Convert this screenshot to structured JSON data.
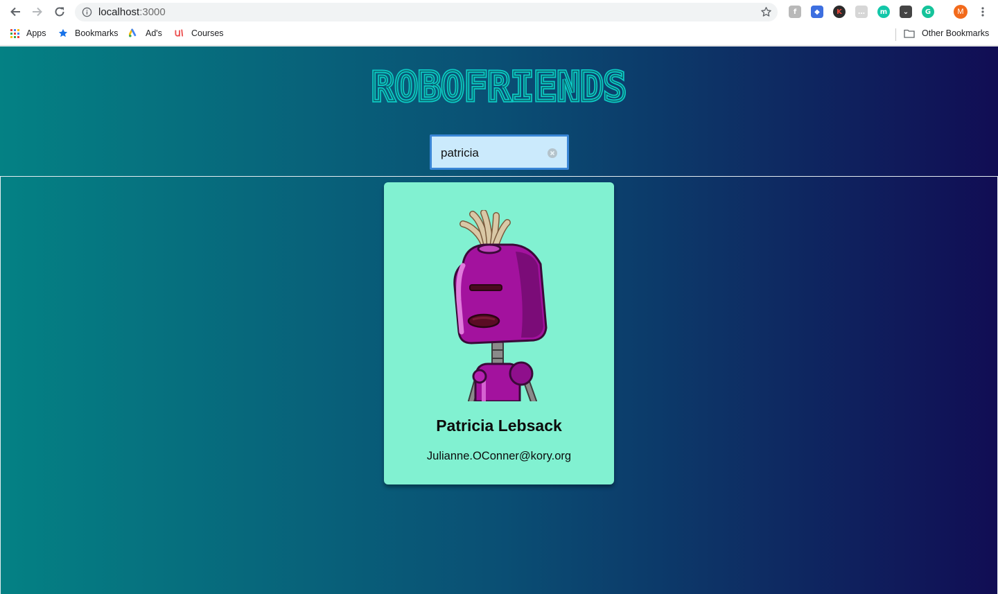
{
  "browser": {
    "url_host": "localhost",
    "url_port": ":3000",
    "profile_initial": "M",
    "bookmarks": [
      {
        "label": "Apps",
        "icon": "apps-grid-icon"
      },
      {
        "label": "Bookmarks",
        "icon": "star-icon"
      },
      {
        "label": "Ad's",
        "icon": "google-ads-icon"
      },
      {
        "label": "Courses",
        "icon": "udemy-icon"
      }
    ],
    "other_bookmarks": "Other Bookmarks",
    "extensions": [
      "f-extension-icon",
      "puzzle-extension-icon",
      "k-extension-icon",
      "chat-extension-icon",
      "m-extension-icon",
      "pocket-icon",
      "grammarly-icon"
    ]
  },
  "app": {
    "title": "ROBOFRIENDS",
    "search": {
      "value": "patricia"
    },
    "robots": [
      {
        "name": "Patricia Lebsack",
        "email": "Julianne.OConner@kory.org"
      }
    ]
  },
  "colors": {
    "gradient_start": "#048184",
    "gradient_end": "#110d54",
    "title": "#0ccac4",
    "card": "#81f1d1",
    "search_bg": "#cbeafc",
    "search_border": "#3a86d6"
  }
}
